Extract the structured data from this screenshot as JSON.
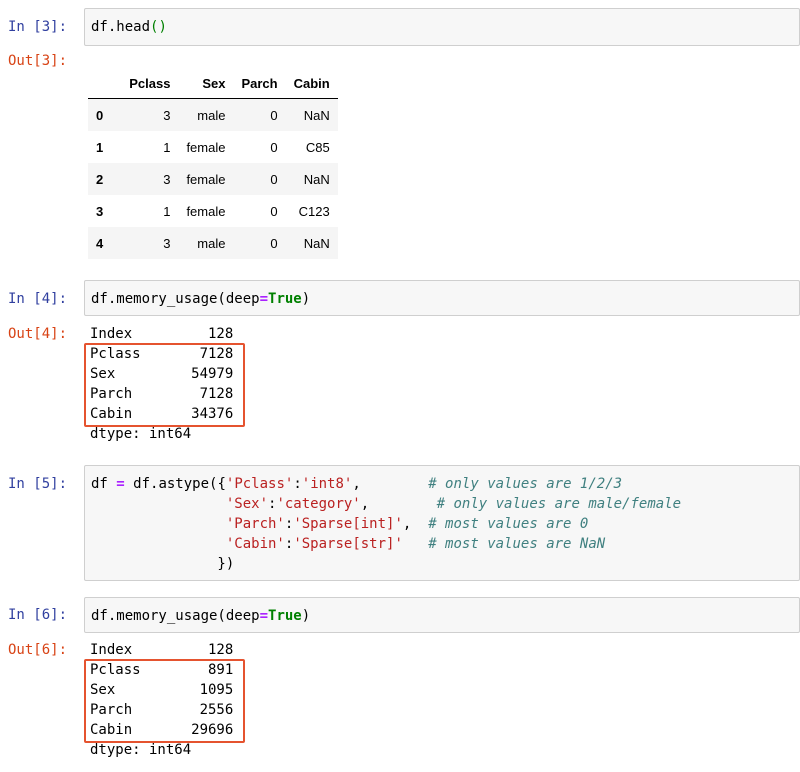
{
  "cells": {
    "c3": {
      "in_prompt": "In [3]:",
      "out_prompt": "Out[3]:",
      "code": {
        "obj": "df.head",
        "parens": "()"
      },
      "table": {
        "columns": [
          "Pclass",
          "Sex",
          "Parch",
          "Cabin"
        ],
        "rows": [
          {
            "idx": "0",
            "vals": [
              "3",
              "male",
              "0",
              "NaN"
            ]
          },
          {
            "idx": "1",
            "vals": [
              "1",
              "female",
              "0",
              "C85"
            ]
          },
          {
            "idx": "2",
            "vals": [
              "3",
              "female",
              "0",
              "NaN"
            ]
          },
          {
            "idx": "3",
            "vals": [
              "1",
              "female",
              "0",
              "C123"
            ]
          },
          {
            "idx": "4",
            "vals": [
              "3",
              "male",
              "0",
              "NaN"
            ]
          }
        ]
      }
    },
    "c4": {
      "in_prompt": "In [4]:",
      "out_prompt": "Out[4]:",
      "code": {
        "pre": "df.memory_usage(deep",
        "eq": "=",
        "kw": "True",
        "post": ")"
      },
      "output": [
        "Index         128",
        "Pclass       7128",
        "Sex         54979",
        "Parch        7128",
        "Cabin       34376",
        "dtype: int64"
      ]
    },
    "c5": {
      "in_prompt": "In [5]:",
      "lines": [
        {
          "a": "df ",
          "op": "=",
          "b": " df.astype({",
          "s1": "'Pclass'",
          "c": ":",
          "s2": "'int8'",
          "d": ",        ",
          "cm": "# only values are 1/2/3"
        },
        {
          "a": "                ",
          "op": "",
          "b": "",
          "s1": "'Sex'",
          "c": ":",
          "s2": "'category'",
          "d": ",        ",
          "cm": "# only values are male/female"
        },
        {
          "a": "                ",
          "op": "",
          "b": "",
          "s1": "'Parch'",
          "c": ":",
          "s2": "'Sparse[int]'",
          "d": ",  ",
          "cm": "# most values are 0"
        },
        {
          "a": "                ",
          "op": "",
          "b": "",
          "s1": "'Cabin'",
          "c": ":",
          "s2": "'Sparse[str]'",
          "d": "   ",
          "cm": "# most values are NaN"
        },
        {
          "a": "               })",
          "op": "",
          "b": "",
          "s1": "",
          "c": "",
          "s2": "",
          "d": "",
          "cm": ""
        }
      ]
    },
    "c6": {
      "in_prompt": "In [6]:",
      "out_prompt": "Out[6]:",
      "code": {
        "pre": "df.memory_usage(deep",
        "eq": "=",
        "kw": "True",
        "post": ")"
      },
      "output": [
        "Index         128",
        "Pclass        891",
        "Sex          1095",
        "Parch        2556",
        "Cabin       29696",
        "dtype: int64"
      ]
    }
  },
  "colors": {
    "in_prompt": "#303f9f",
    "out_prompt": "#d84315",
    "highlight_box": "#e5532f",
    "keyword": "#008000",
    "operator": "#aa22ff",
    "string": "#ba2121",
    "comment": "#408080"
  }
}
